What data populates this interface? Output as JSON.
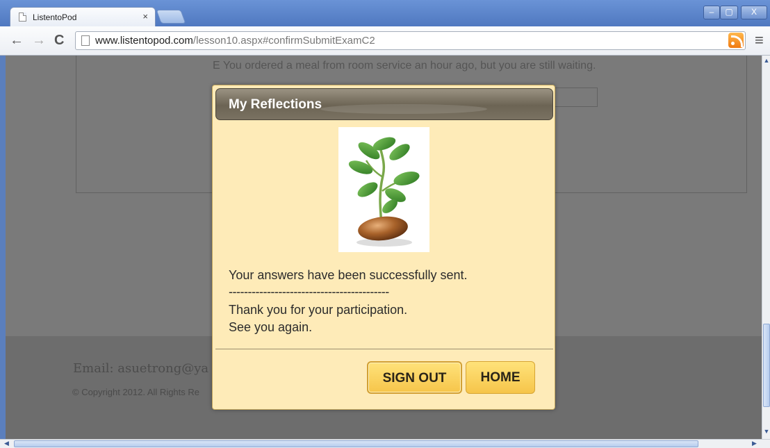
{
  "browser": {
    "tab_title": "ListentoPod",
    "tab_close": "×",
    "url_host": "www.listentopod.com",
    "url_path": "/lesson10.aspx#confirmSubmitExamC2",
    "win_min": "–",
    "win_max": "▢",
    "win_close": "X"
  },
  "background_page": {
    "option_text": "E   You ordered a meal from room service an hour ago, but you are still waiting.",
    "footer_email": "Email: asuetrong@ya",
    "footer_copyright": "© Copyright 2012. All Rights Re"
  },
  "modal": {
    "title": "My Reflections",
    "image_alt": "seedling-image",
    "message_line1": "Your answers have been successfully sent.",
    "message_separator": "------------------------------------------",
    "message_line2": "Thank you for your participation.",
    "message_line3": "See you again.",
    "sign_out_label": "SIGN OUT",
    "home_label": "HOME"
  },
  "colors": {
    "modal_bg": "#feebb8",
    "header_bg": "#6c6454",
    "button_bg": "#f6c54a",
    "overlay": "#7a7a7a"
  }
}
